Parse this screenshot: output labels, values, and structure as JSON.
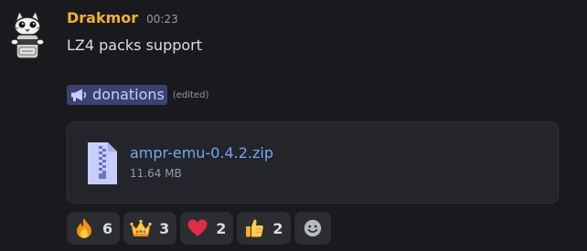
{
  "message": {
    "username": "Drakmor",
    "timestamp": "00:23",
    "content": "LZ4 packs support",
    "channel_mention": {
      "icon": "megaphone-icon",
      "name": "donations"
    },
    "edited_label": "(edited)",
    "username_color": "#f0b232"
  },
  "attachment": {
    "icon": "zip-file-icon",
    "filename": "ampr-emu-0.4.2.zip",
    "size": "11.64 MB"
  },
  "reactions": [
    {
      "emoji": "fire-emoji",
      "count": "6"
    },
    {
      "emoji": "crown-emoji",
      "count": "3"
    },
    {
      "emoji": "heart-emoji",
      "count": "2"
    },
    {
      "emoji": "thumbs-up-emoji",
      "count": "2"
    }
  ],
  "add_reaction_icon": "smiley-add-reaction-icon",
  "colors": {
    "background": "#1a1a1e",
    "link": "#72a6f1",
    "mention_bg": "#3c4270",
    "mention_text": "#c9cdfb"
  }
}
